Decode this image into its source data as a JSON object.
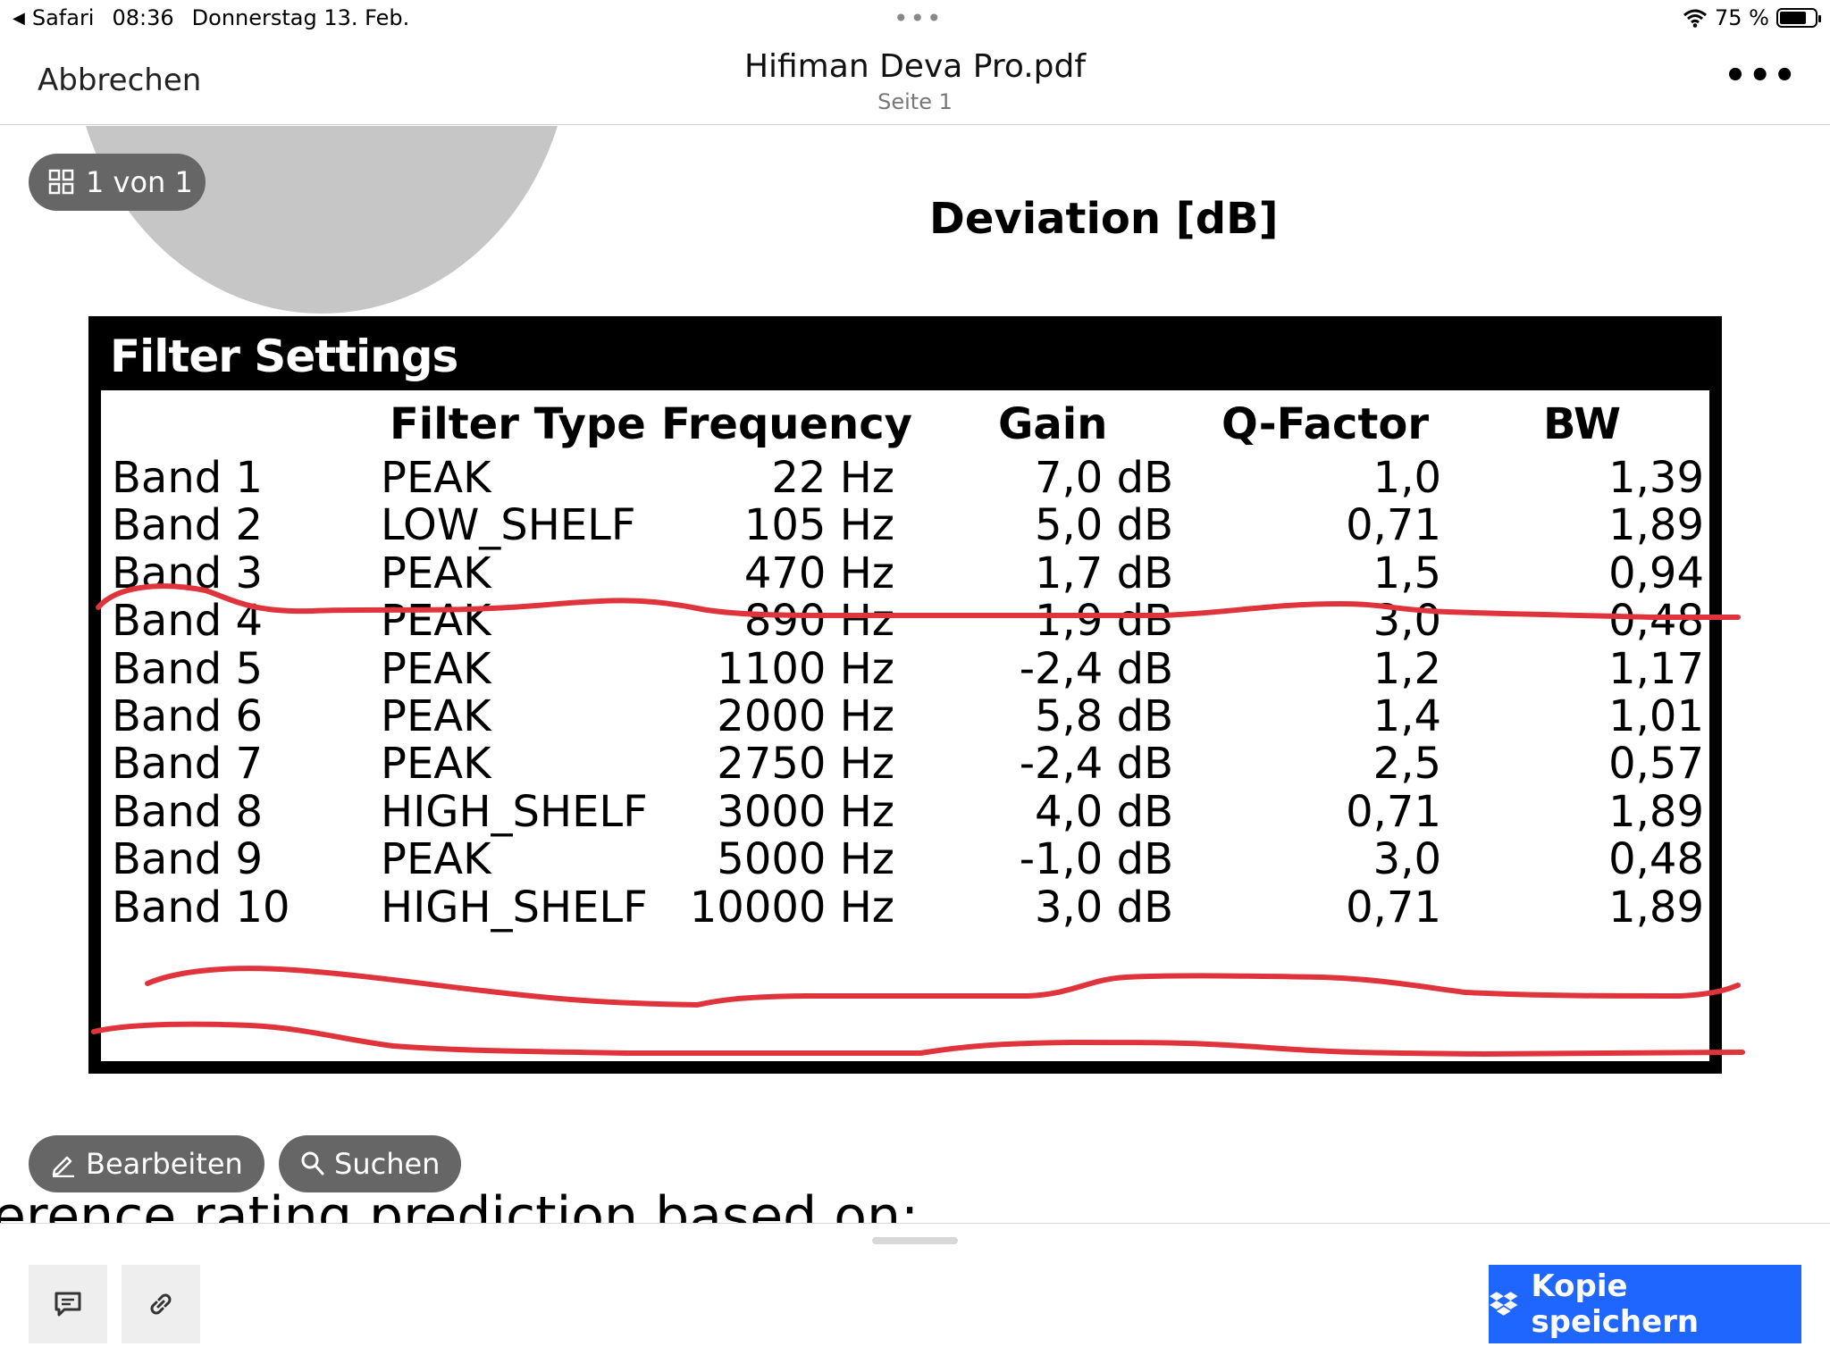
{
  "status_bar": {
    "back_app": "Safari",
    "time": "08:36",
    "date": "Donnerstag 13. Feb.",
    "battery": "75 %",
    "battery_level": 0.75
  },
  "nav": {
    "cancel_label": "Abbrechen",
    "title": "Hifiman Deva Pro.pdf",
    "subtitle": "Seite 1",
    "more_icon": "ellipsis-icon"
  },
  "page_indicator": "1 von 1",
  "document": {
    "deviation_title": "Deviation [dB]",
    "filter_title": "Filter Settings",
    "columns": [
      "Filter Type",
      "Frequency",
      "Gain",
      "Q-Factor",
      "BW"
    ],
    "rows": [
      {
        "band": "Band 1",
        "type": "PEAK",
        "freq": "22 Hz",
        "gain": "7,0 dB",
        "q": "1,0",
        "bw": "1,39"
      },
      {
        "band": "Band 2",
        "type": "LOW_SHELF",
        "freq": "105 Hz",
        "gain": "5,0 dB",
        "q": "0,71",
        "bw": "1,89"
      },
      {
        "band": "Band 3",
        "type": "PEAK",
        "freq": "470 Hz",
        "gain": "1,7 dB",
        "q": "1,5",
        "bw": "0,94"
      },
      {
        "band": "Band 4",
        "type": "PEAK",
        "freq": "890 Hz",
        "gain": "1,9 dB",
        "q": "3,0",
        "bw": "0,48"
      },
      {
        "band": "Band 5",
        "type": "PEAK",
        "freq": "1100 Hz",
        "gain": "-2,4 dB",
        "q": "1,2",
        "bw": "1,17"
      },
      {
        "band": "Band 6",
        "type": "PEAK",
        "freq": "2000 Hz",
        "gain": "5,8 dB",
        "q": "1,4",
        "bw": "1,01"
      },
      {
        "band": "Band 7",
        "type": "PEAK",
        "freq": "2750 Hz",
        "gain": "-2,4 dB",
        "q": "2,5",
        "bw": "0,57"
      },
      {
        "band": "Band 8",
        "type": "HIGH_SHELF",
        "freq": "3000 Hz",
        "gain": "4,0 dB",
        "q": "0,71",
        "bw": "1,89"
      },
      {
        "band": "Band 9",
        "type": "PEAK",
        "freq": "5000 Hz",
        "gain": "-1,0 dB",
        "q": "3,0",
        "bw": "0,48"
      },
      {
        "band": "Band 10",
        "type": "HIGH_SHELF",
        "freq": "10000 Hz",
        "gain": "3,0 dB",
        "q": "0,71",
        "bw": "1,89"
      }
    ],
    "struck_bands": [
      "Band 3",
      "Band 9",
      "Band 10"
    ],
    "annotation_color": "#e0343c",
    "tail_text": "erence rating prediction based on:"
  },
  "floating_buttons": {
    "edit_label": "Bearbeiten",
    "search_label": "Suchen"
  },
  "bottom_bar": {
    "comment_icon": "comment-icon",
    "link_icon": "link-icon",
    "save_label": "Kopie speichern",
    "save_color": "#1f66ff"
  }
}
